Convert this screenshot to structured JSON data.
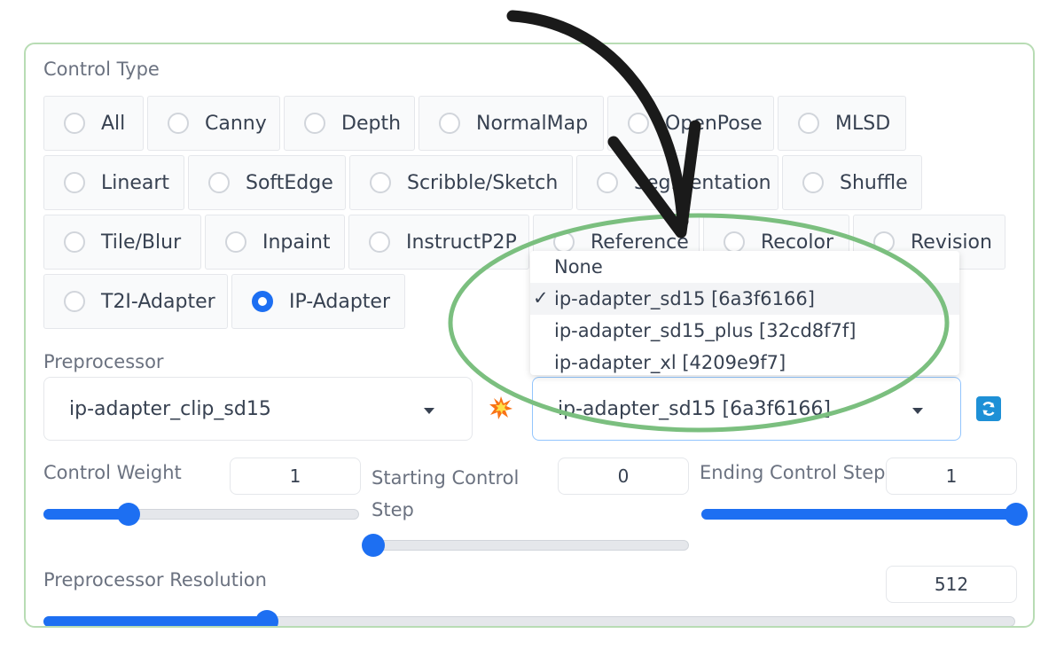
{
  "control_type": {
    "label": "Control Type",
    "options": [
      "All",
      "Canny",
      "Depth",
      "NormalMap",
      "OpenPose",
      "MLSD",
      "Lineart",
      "SoftEdge",
      "Scribble/Sketch",
      "Segmentation",
      "Shuffle",
      "Tile/Blur",
      "Inpaint",
      "InstructP2P",
      "Reference",
      "Recolor",
      "Revision",
      "T2I-Adapter",
      "IP-Adapter"
    ],
    "selected": "IP-Adapter"
  },
  "preprocessor": {
    "label": "Preprocessor",
    "value": "ip-adapter_clip_sd15"
  },
  "model": {
    "value": "ip-adapter_sd15 [6a3f6166]",
    "options": [
      "None",
      "ip-adapter_sd15 [6a3f6166]",
      "ip-adapter_sd15_plus [32cd8f7f]",
      "ip-adapter_xl [4209e9f7]"
    ],
    "selected_index": 1,
    "checkmark": "✓"
  },
  "control_weight": {
    "label": "Control Weight",
    "value": "1",
    "fraction": 0.27
  },
  "starting_step": {
    "label": "Starting Control Step",
    "value": "0",
    "fraction": 0.0
  },
  "ending_step": {
    "label": "Ending Control Step",
    "value": "1",
    "fraction": 1.0
  },
  "preprocessor_resolution": {
    "label": "Preprocessor Resolution",
    "value": "512",
    "fraction": 0.23
  },
  "icons": {
    "run_preprocessor": "explosion-icon",
    "refresh_models": "refresh-icon"
  },
  "colors": {
    "accent": "#1d6ff2",
    "highlight_ellipse": "#7bbf7f",
    "arrow": "#1a1a1a"
  }
}
